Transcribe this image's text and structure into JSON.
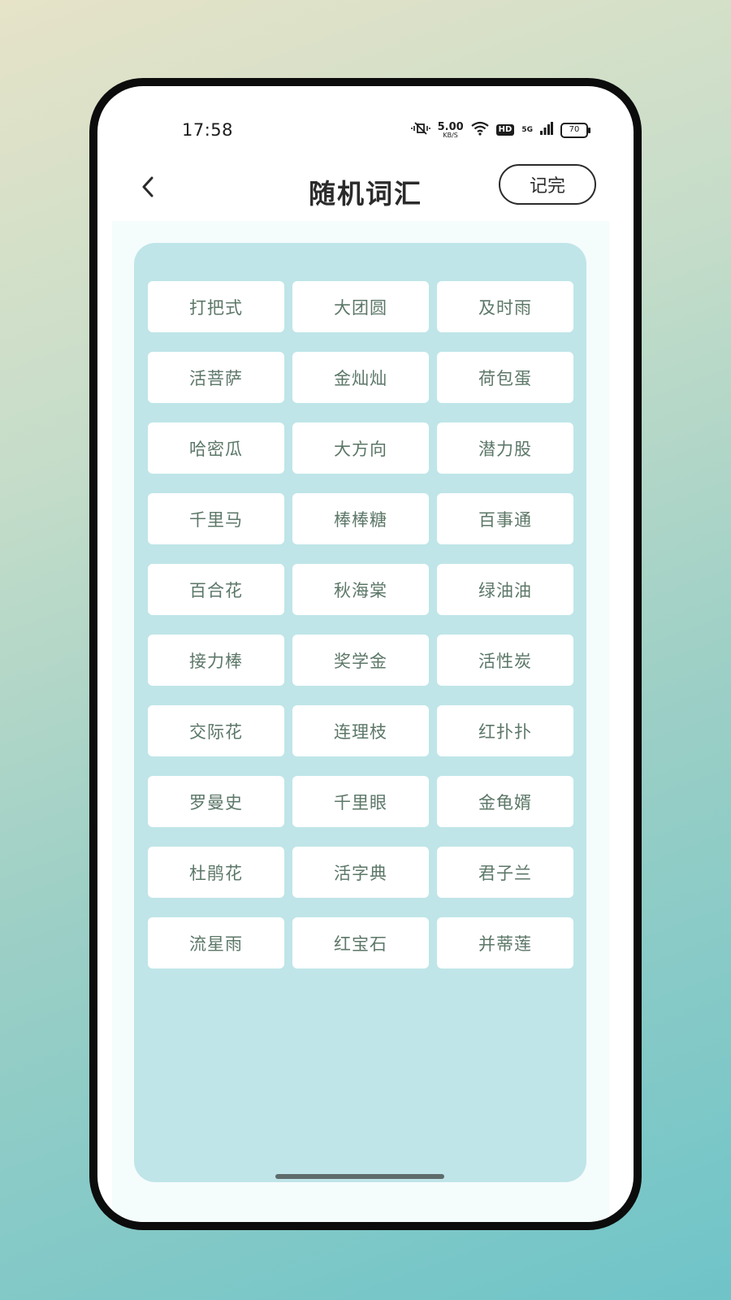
{
  "status_bar": {
    "time": "17:58",
    "net_speed_value": "5.00",
    "net_speed_unit": "KB/S",
    "hd_label": "HD",
    "signal_label": "5G",
    "battery_level": "70"
  },
  "header": {
    "title": "随机词汇",
    "done_label": "记完",
    "back_icon": "chevron-left-icon"
  },
  "words": [
    "打把式",
    "大团圆",
    "及时雨",
    "活菩萨",
    "金灿灿",
    "荷包蛋",
    "哈密瓜",
    "大方向",
    "潜力股",
    "千里马",
    "棒棒糖",
    "百事通",
    "百合花",
    "秋海棠",
    "绿油油",
    "接力棒",
    "奖学金",
    "活性炭",
    "交际花",
    "连理枝",
    "红扑扑",
    "罗曼史",
    "千里眼",
    "金龟婿",
    "杜鹃花",
    "活字典",
    "君子兰",
    "流星雨",
    "红宝石",
    "并蒂莲"
  ],
  "colors": {
    "panel": "#bfe5e8",
    "word_text": "#5c7768",
    "accent": "#2b2b2b"
  }
}
